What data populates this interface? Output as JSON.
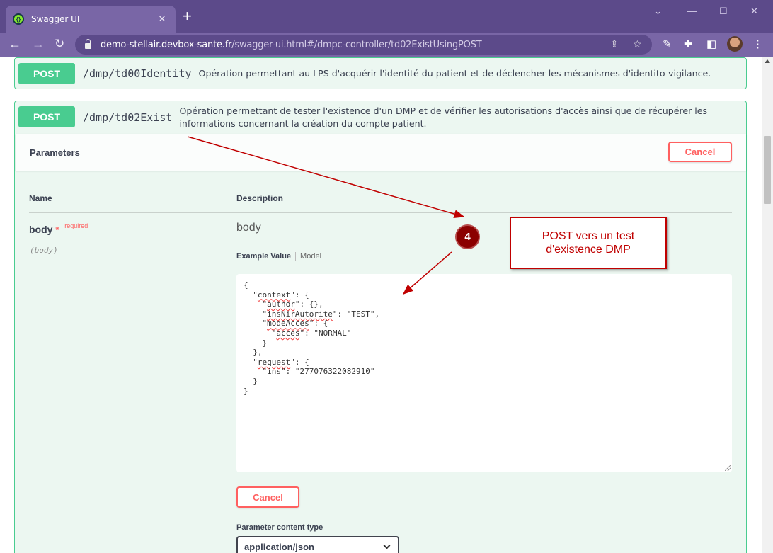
{
  "browser": {
    "tab_title": "Swagger UI",
    "new_tab_label": "+",
    "url_host": "demo-stellair.devbox-sante.fr",
    "url_path": "/swagger-ui.html#/dmpc-controller/td02ExistUsingPOST"
  },
  "operations": [
    {
      "method": "POST",
      "path": "/dmp/td00Identity",
      "description": "Opération permettant au LPS d'acquérir l'identité du patient et de déclencher les mécanismes d'identito-vigilance."
    },
    {
      "method": "POST",
      "path": "/dmp/td02Exist",
      "description_line1": "Opération permettant de tester l'existence d'un DMP et de vérifier les autorisations d'accès ainsi que de récupérer les",
      "description_line2": "informations concernant la création du compte patient."
    }
  ],
  "parameters": {
    "section_title": "Parameters",
    "cancel_label": "Cancel",
    "col_name": "Name",
    "col_description": "Description",
    "param_name": "body",
    "required_star": "*",
    "required_label": "required",
    "param_in": "(body)",
    "param_description": "body",
    "tab_example": "Example Value",
    "tab_model": "Model",
    "content_type_label": "Parameter content type",
    "content_type_value": "application/json"
  },
  "example_json": {
    "l1": "{",
    "l2_key": "context",
    "l2_rest": ": {",
    "l3_key": "author",
    "l3_rest": ": {},",
    "l4_key": "insNirAutorite",
    "l4_rest": ": \"TEST\",",
    "l5_key": "modeAcces",
    "l5_rest": ": {",
    "l6_key": "acces",
    "l6_rest": ": \"NORMAL\"",
    "l7": "}",
    "l8": "},",
    "l9_key": "request",
    "l9_rest": ": {",
    "l10_key": "ins",
    "l10_rest": ": \"277076322082910\"",
    "l11": "}",
    "l12": "}"
  },
  "annotation": {
    "callout_line1": "POST vers un test",
    "callout_line2": "d'existence DMP",
    "step_number": "4",
    "color": "#c00000"
  }
}
